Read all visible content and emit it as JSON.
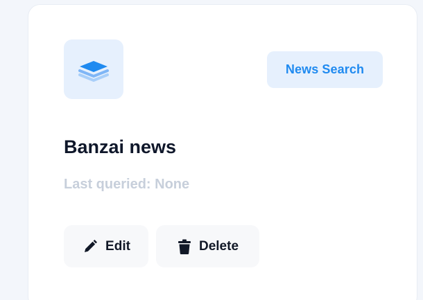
{
  "card": {
    "badge_label": "News Search",
    "title": "Banzai news",
    "subtitle": "Last queried: None",
    "actions": {
      "edit_label": "Edit",
      "delete_label": "Delete"
    }
  },
  "icons": {
    "tile_icon": "layers-icon",
    "edit_icon": "pencil-icon",
    "delete_icon": "trash-icon"
  },
  "colors": {
    "accent": "#1f8af0",
    "badge_bg": "#e6f0fd",
    "title": "#0f172a",
    "muted": "#c7cfdb"
  }
}
